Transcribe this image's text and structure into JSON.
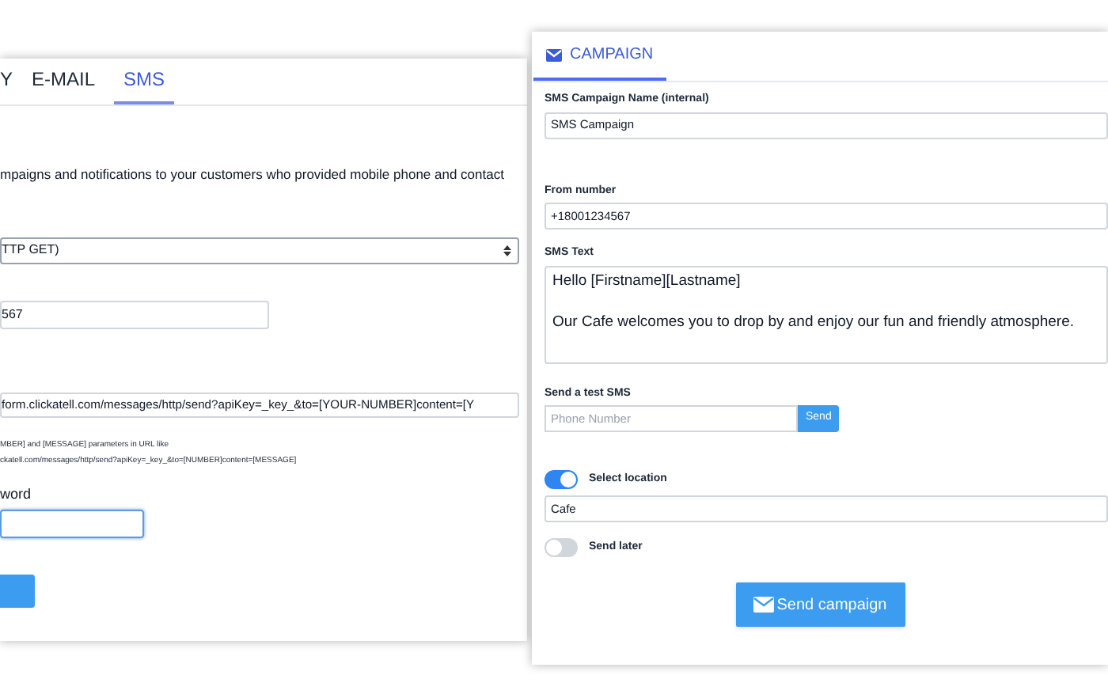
{
  "settings_panel": {
    "tabs": [
      {
        "label": "Y",
        "selected": false
      },
      {
        "label": "E-MAIL",
        "selected": false
      },
      {
        "label": "SMS",
        "selected": true
      }
    ],
    "description": "mpaigns and notifications to your customers who provided mobile phone and contact",
    "method_select": {
      "value": "TTP GET)"
    },
    "number_field": {
      "value": "567"
    },
    "url_field": {
      "value": "form.clickatell.com/messages/http/send?apiKey=_key_&to=[YOUR-NUMBER]content=[Y"
    },
    "hint_lines": [
      "MBER] and [MESSAGE] parameters in URL like",
      "ckatell.com/messages/http/send?apiKey=_key_&to=[NUMBER]content=[MESSAGE]"
    ],
    "password_label": "word",
    "password_field": {
      "focused": true
    }
  },
  "campaign_panel": {
    "tab": {
      "label": "CAMPAIGN",
      "selected": true
    },
    "name_label": "SMS Campaign Name (internal)",
    "name_value": "SMS Campaign",
    "from_label": "From number",
    "from_value": "+18001234567",
    "text_label": "SMS Text",
    "text_lines": [
      "Hello [Firstname][Lastname]",
      "Our Cafe welcomes you to drop by and enjoy our fun and friendly atmosphere."
    ],
    "test_label": "Send a test SMS",
    "test_placeholder": "Phone Number",
    "test_button": "Send",
    "toggles": [
      {
        "label": "Select location",
        "on": true
      },
      {
        "label": "Send later",
        "on": false
      }
    ],
    "location_value": "Cafe",
    "submit_button": "Send campaign"
  }
}
